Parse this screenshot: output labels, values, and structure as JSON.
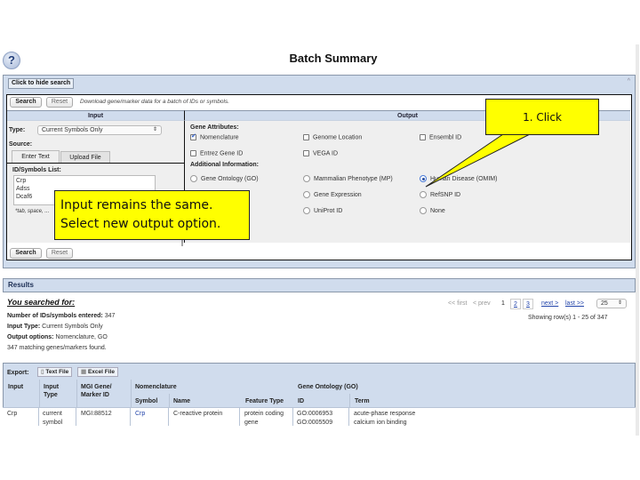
{
  "header": {
    "help_icon": "?",
    "title": "Batch Summary"
  },
  "search_panel": {
    "hide_label": "Click to hide search",
    "collapse_icon": "^",
    "search_label": "Search",
    "reset_label": "Reset",
    "description": "Download gene/marker data for a batch of IDs or symbols.",
    "input_header": "Input",
    "output_header": "Output",
    "input": {
      "type_label": "Type:",
      "type_value": "Current Symbols Only",
      "source_label": "Source:",
      "tabs": [
        "Enter Text",
        "Upload File"
      ],
      "list_label": "ID/Symbols List:",
      "list_values": [
        "Crp",
        "Adss",
        "Dcaf6"
      ],
      "hint": "*tab, space, ..."
    },
    "output": {
      "gene_attributes_label": "Gene Attributes:",
      "gene_attributes": [
        {
          "label": "Nomenclature",
          "checked": true
        },
        {
          "label": "Genome Location",
          "checked": false
        },
        {
          "label": "Ensembl ID",
          "checked": false
        },
        {
          "label": "Entrez Gene ID",
          "checked": false
        },
        {
          "label": "VEGA ID",
          "checked": false
        }
      ],
      "additional_label": "Additional Information:",
      "additional_options": [
        {
          "label": "Gene Ontology (GO)",
          "selected": false
        },
        {
          "label": "Mammalian Phenotype (MP)",
          "selected": false
        },
        {
          "label": "Human Disease (OMIM)",
          "selected": true
        },
        {
          "label": "Gene Expression",
          "selected": false
        },
        {
          "label": "RefSNP ID",
          "selected": false
        },
        {
          "label": "UniProt ID",
          "selected": false
        },
        {
          "label": "None",
          "selected": false
        }
      ]
    },
    "bottom_search_label": "Search",
    "bottom_reset_label": "Reset"
  },
  "callouts": {
    "click": "1. Click",
    "note_line1": "Input remains the same.",
    "note_line2": "Select new output option."
  },
  "results": {
    "title": "Results",
    "searched_for": "You searched for:",
    "summary": [
      {
        "label": "Number of IDs/symbols entered:",
        "value": "347"
      },
      {
        "label": "Input Type:",
        "value": "Current Symbols Only"
      },
      {
        "label": "Output options:",
        "value": "Nomenclature, GO"
      }
    ],
    "found": "347 matching genes/markers found.",
    "pager": {
      "first": "<< first",
      "prev": "< prev",
      "pages": [
        "1",
        "2",
        "3"
      ],
      "current": "1",
      "next": "next >",
      "last": "last >>",
      "page_size": "25",
      "showing": "Showing row(s) 1 - 25 of 347"
    }
  },
  "table": {
    "export_label": "Export:",
    "export_text": "Text File",
    "export_excel": "Excel File",
    "headers": {
      "input": "Input",
      "input_type": "Input Type",
      "marker_id": "MGI Gene/ Marker ID",
      "nomenclature": "Nomenclature",
      "symbol": "Symbol",
      "name": "Name",
      "feature_type": "Feature Type",
      "go": "Gene Ontology (GO)",
      "go_id": "ID",
      "go_term": "Term"
    },
    "rows": [
      {
        "input": "Crp",
        "input_type": "current symbol",
        "marker_id": "MGI:88512",
        "symbol": "Crp",
        "name": "C-reactive protein",
        "feature_type": "protein coding gene",
        "go_ids": [
          "GO:0006953",
          "GO:0005509"
        ],
        "go_terms": [
          "acute-phase response",
          "calcium ion binding"
        ]
      }
    ]
  }
}
